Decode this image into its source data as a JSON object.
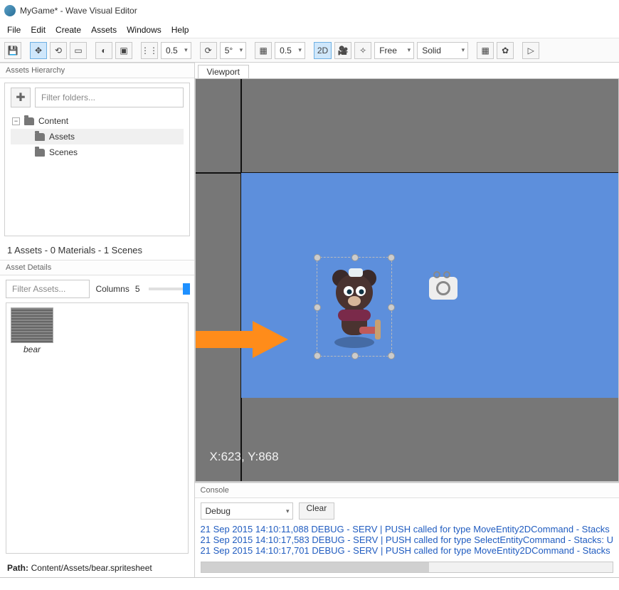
{
  "title": "MyGame* - Wave Visual Editor",
  "menu": [
    "File",
    "Edit",
    "Create",
    "Assets",
    "Windows",
    "Help"
  ],
  "toolbar": {
    "scale_dropdown_a": "0.5",
    "angle_dropdown": "5°",
    "scale_dropdown_b": "0.5",
    "view_mode": "2D",
    "camera_mode": "Free",
    "render_mode": "Solid"
  },
  "hierarchy": {
    "header": "Assets Hierarchy",
    "filter_placeholder": "Filter folders...",
    "root": "Content",
    "children": [
      "Assets",
      "Scenes"
    ],
    "status": "1 Assets - 0 Materials - 1 Scenes"
  },
  "details": {
    "header": "Asset Details",
    "filter_placeholder": "Filter Assets...",
    "columns_label": "Columns",
    "columns_value": "5",
    "asset_name": "bear",
    "path_label": "Path:",
    "path_value": "Content/Assets/bear.spritesheet"
  },
  "viewport": {
    "tab_label": "Viewport",
    "coord_readout": "X:623, Y:868"
  },
  "console": {
    "header": "Console",
    "level": "Debug",
    "clear": "Clear",
    "lines": [
      "21 Sep 2015 14:10:11,088 DEBUG - SERV   | PUSH called for type MoveEntity2DCommand - Stacks",
      "21 Sep 2015 14:10:17,583 DEBUG - SERV   | PUSH called for type SelectEntityCommand - Stacks: U",
      "21 Sep 2015 14:10:17,701 DEBUG - SERV   | PUSH called for type MoveEntity2DCommand - Stacks"
    ]
  }
}
